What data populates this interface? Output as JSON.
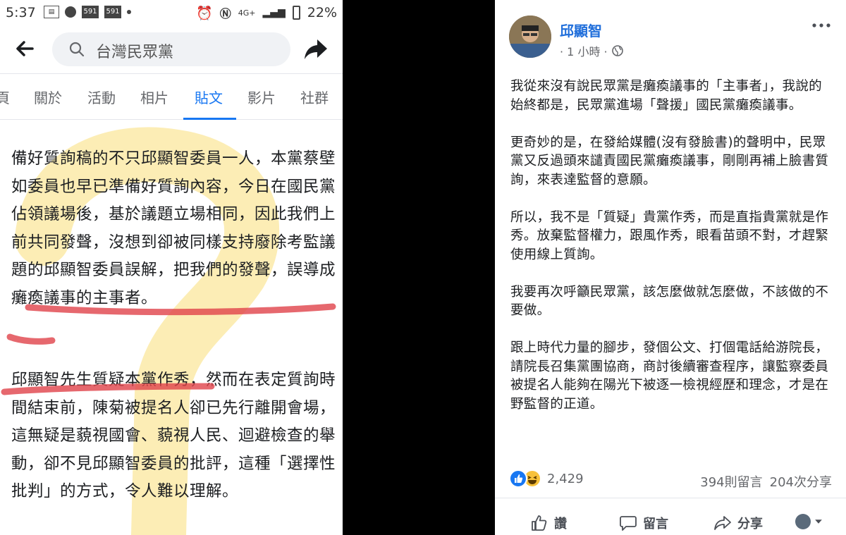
{
  "status_bar": {
    "time": "5:37",
    "badge1": "591",
    "badge2": "591",
    "network": "4G+",
    "battery": "22%"
  },
  "search": {
    "query": "台灣民眾黨"
  },
  "tabs": [
    {
      "label": "頁"
    },
    {
      "label": "關於"
    },
    {
      "label": "活動"
    },
    {
      "label": "相片"
    },
    {
      "label": "貼文",
      "active": true
    },
    {
      "label": "影片"
    },
    {
      "label": "社群"
    }
  ],
  "left_article": {
    "paragraph1": "備好質詢稿的不只邱顯智委員一人，本黨蔡壁如委員也早已準備好質詢內容，今日在國民黨佔領議場後，基於議題立場相同，因此我們上前共同發聲，沒想到卻被同樣支持廢除考監議題的邱顯智委員誤解，把我們的發聲，誤導成癱瘓議事的主事者。",
    "paragraph2": "邱顯智先生質疑本黨作秀，然而在表定質詢時間結束前，陳菊被提名人卻已先行離開會場，這無疑是藐視國會、藐視人民、迴避檢查的舉動，卻不見邱顯智委員的批評，這種「選擇性批判」的方式，令人難以理解。"
  },
  "right_post": {
    "author": "邱顯智",
    "time": "· 1 小時 ·",
    "paragraphs": [
      "我從來沒有說民眾黨是癱瘓議事的「主事者」，我說的始終都是，民眾黨進場「聲援」國民黨癱瘓議事。",
      "更奇妙的是，在發給媒體(沒有發臉書)的聲明中，民眾黨又反過頭來譴責國民黨癱瘓議事，剛剛再補上臉書質詢，來表達監督的意願。",
      "所以，我不是「質疑」貴黨作秀，而是直指貴黨就是作秀。放棄監督權力，跟風作秀，眼看苗頭不對，才趕緊使用線上質詢。",
      "我要再次呼籲民眾黨，該怎麼做就怎麼做，不該做的不要做。",
      "跟上時代力量的腳步，發個公文、打個電話給游院長，請院長召集黨團協商，商討後續審查程序，讓監察委員被提名人能夠在陽光下被逐一檢視經歷和理念，才是在野監督的正道。"
    ],
    "reaction_count": "2,429",
    "comments": "394則留言",
    "shares": "204次分享",
    "actions": {
      "like": "讚",
      "comment": "留言",
      "share": "分享"
    }
  },
  "colors": {
    "facebook_blue": "#1877f2",
    "annotation_red": "#e0424a",
    "highlight_yellow": "#f9d65c"
  }
}
